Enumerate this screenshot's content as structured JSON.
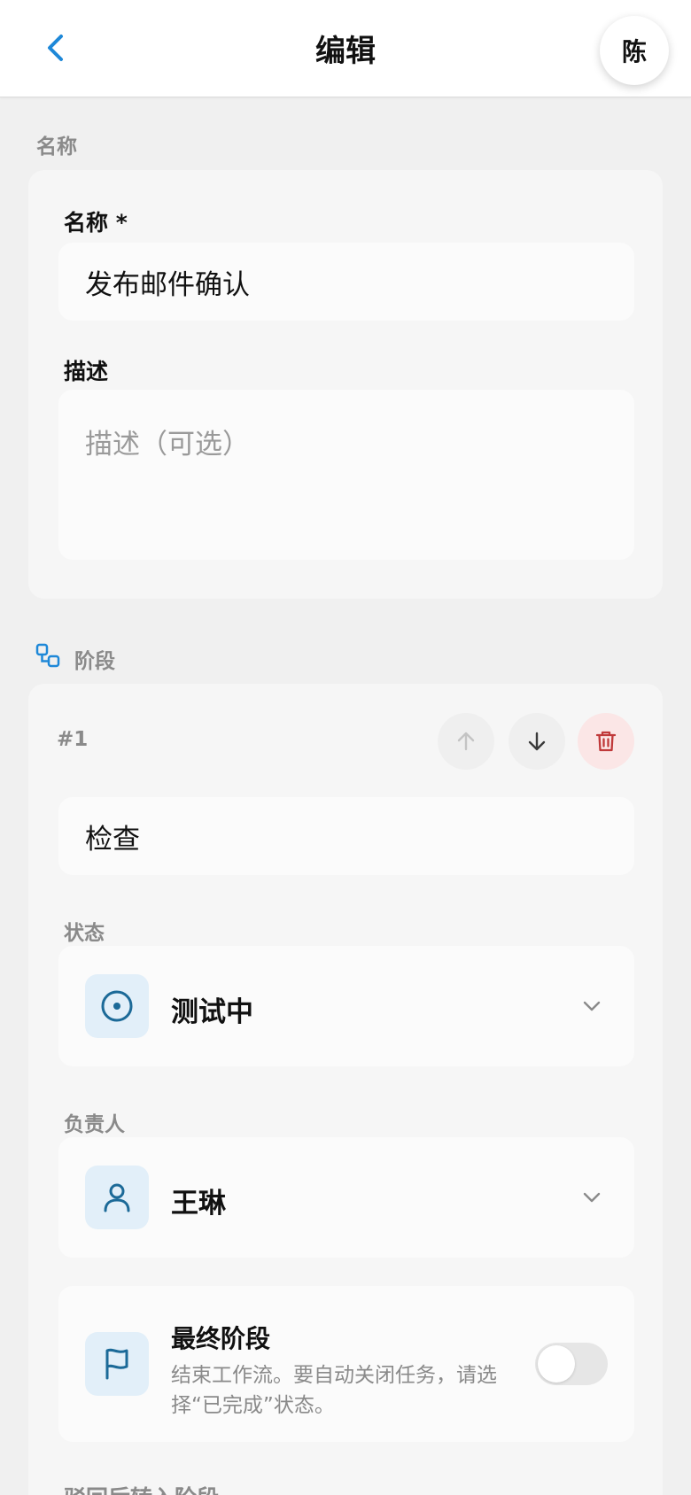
{
  "header": {
    "title": "编辑",
    "avatar_text": "陈"
  },
  "name_section": {
    "label": "名称",
    "name_label": "名称 *",
    "name_value": "发布邮件确认",
    "description_label": "描述",
    "description_placeholder": "描述（可选）",
    "description_value": ""
  },
  "stages_section": {
    "label": "阶段",
    "stage": {
      "number": "#1",
      "name_value": "检查",
      "status_label": "状态",
      "status_value": "测试中",
      "assignee_label": "负责人",
      "assignee_value": "王琳",
      "final_title": "最终阶段",
      "final_description": "结束工作流。要自动关闭任务，请选择“已完成”状态。",
      "final_enabled": false
    },
    "next_label": "驳回后转入阶段"
  },
  "colors": {
    "accent": "#1e88d8",
    "icon_dark": "#1c6a98",
    "danger": "#c0393a",
    "danger_bg": "#fbe6e6"
  }
}
